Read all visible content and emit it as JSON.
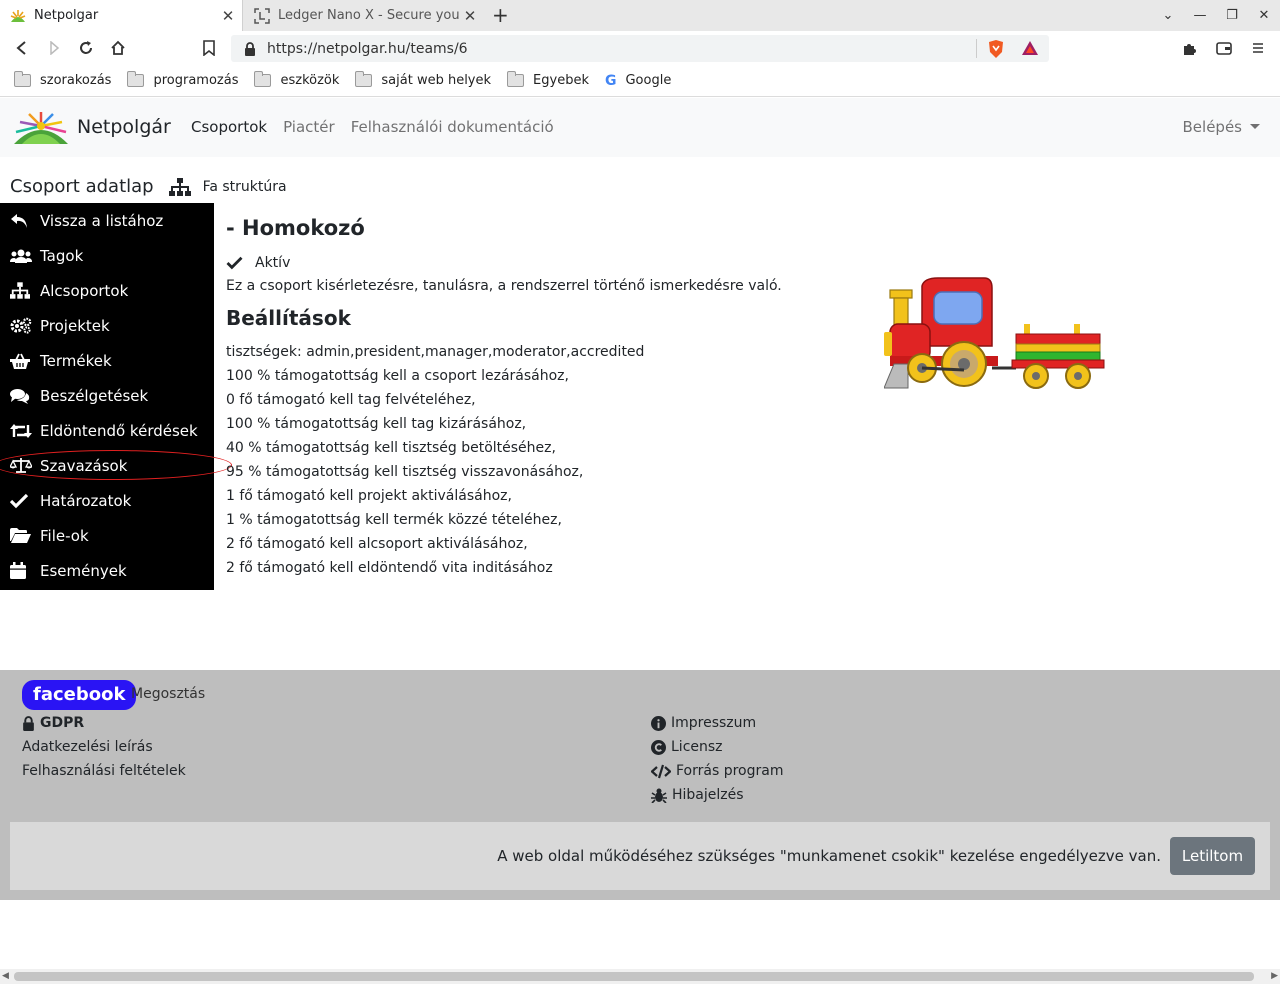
{
  "browser": {
    "tabs": [
      {
        "title": "Netpolgar",
        "active": true
      },
      {
        "title": "Ledger Nano X - Secure your crypto",
        "active": false
      }
    ],
    "url": "https://netpolgar.hu/teams/6",
    "bookmarks": [
      "szorakozás",
      "programozás",
      "eszközök",
      "saját web helyek",
      "Egyebek",
      "Google"
    ]
  },
  "site": {
    "brand": "Netpolgár",
    "nav": [
      "Csoportok",
      "Piactér",
      "Felhasználói dokumentáció"
    ],
    "login": "Belépés"
  },
  "page": {
    "title": "Csoport adatlap",
    "tree_link": "Fa struktúra"
  },
  "sidebar": {
    "items": [
      {
        "label": "Vissza a listához",
        "icon": "reply-icon"
      },
      {
        "label": "Tagok",
        "icon": "users-icon"
      },
      {
        "label": "Alcsoportok",
        "icon": "sitemap-icon"
      },
      {
        "label": "Projektek",
        "icon": "cogs-icon"
      },
      {
        "label": "Termékek",
        "icon": "basket-icon"
      },
      {
        "label": "Beszélgetések",
        "icon": "comments-icon"
      },
      {
        "label": "Eldöntendő kérdések",
        "icon": "retweet-icon"
      },
      {
        "label": "Szavazások",
        "icon": "balance-scale-icon"
      },
      {
        "label": "Határozatok",
        "icon": "check-icon"
      },
      {
        "label": "File-ok",
        "icon": "folder-open-icon"
      },
      {
        "label": "Események",
        "icon": "calendar-icon"
      }
    ],
    "highlight_color": "#e02020"
  },
  "main": {
    "group_name": "- Homokozó",
    "status": "Aktív",
    "description": "Ez a csoport kisérletezésre, tanulásra, a rendszerrel történő ismerkedésre való.",
    "settings_title": "Beállítások",
    "settings": [
      "tisztségek: admin,president,manager,moderator,accredited",
      "100 % támogatottság kell a csoport lezárásához,",
      "0 fő támogató kell tag felvételéhez,",
      "100 % támogatottság kell tag kizárásához,",
      "40 % támogatottság kell tisztség betöltéséhez,",
      "95 % támogatottság kell tisztség visszavonásához,",
      "1 fő támogató kell projekt aktiválásához,",
      "1 % támogatottság kell termék közzé tételéhez,",
      "2 fő támogató kell alcsoport aktiválásához,",
      "2 fő támogató kell eldöntendő vita inditásához"
    ]
  },
  "footer": {
    "facebook": "facebook",
    "share": "Megosztás",
    "left_links": [
      "GDPR",
      "Adatkezelési leírás",
      "Felhasználási feltételek"
    ],
    "right_links": [
      {
        "label": "Impresszum",
        "icon": "info-circle-icon"
      },
      {
        "label": "Licensz",
        "icon": "copyright-icon"
      },
      {
        "label": "Forrás program",
        "icon": "code-icon"
      },
      {
        "label": "Hibajelzés",
        "icon": "bug-icon"
      }
    ],
    "cookie_text": "A web oldal működéséhez szükséges \"munkamenet csokik\" kezelése engedélyezve van.",
    "cookie_button": "Letiltom"
  },
  "colors": {
    "sidebar_bg": "#000000",
    "footer_bg": "#bebebe",
    "facebook_bg": "#2a14f4",
    "cookie_button_bg": "#6c757d"
  }
}
